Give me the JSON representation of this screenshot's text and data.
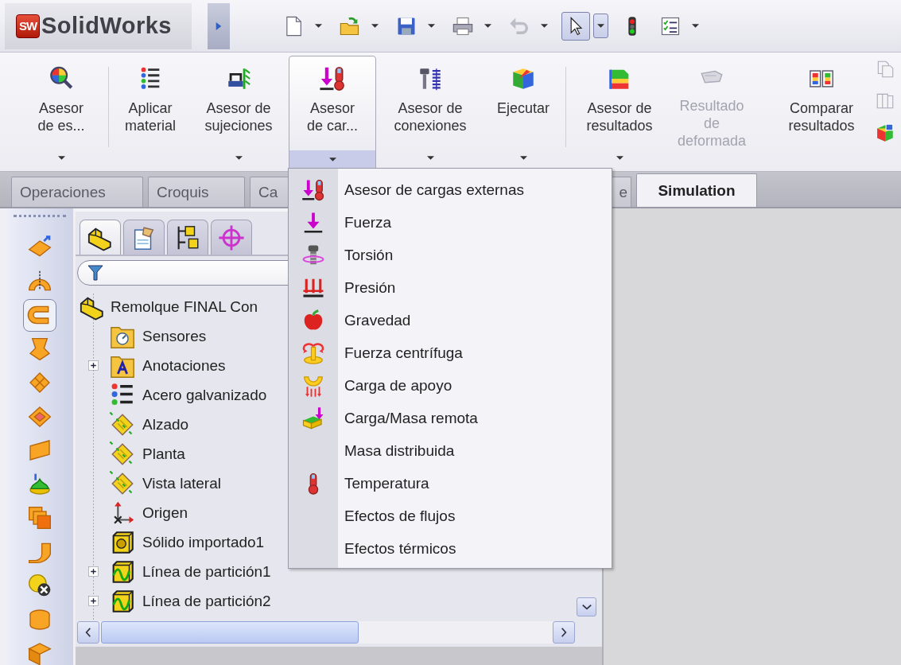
{
  "app": {
    "logo_mark": "SW",
    "name": "SolidWorks"
  },
  "quick_toolbar": [
    {
      "pressed": false,
      "disabled": false,
      "dropdown": true
    },
    {
      "pressed": false,
      "disabled": false,
      "dropdown": true
    },
    {
      "pressed": false,
      "disabled": false,
      "dropdown": true
    },
    {
      "pressed": false,
      "disabled": false,
      "dropdown": true
    },
    {
      "pressed": false,
      "disabled": true,
      "dropdown": true
    },
    {
      "pressed": true,
      "disabled": false,
      "dropdown": true
    },
    {
      "pressed": false,
      "disabled": false,
      "dropdown": false
    },
    {
      "pressed": false,
      "disabled": false,
      "dropdown": true
    }
  ],
  "ribbon": {
    "buttons": [
      {
        "lines": [
          "Asesor",
          "de es..."
        ],
        "dropdown": true,
        "pressed": false,
        "disabled": false
      },
      {
        "lines": [
          "Aplicar",
          "material"
        ],
        "dropdown": false,
        "pressed": false,
        "disabled": false
      },
      {
        "lines": [
          "Asesor de",
          "sujeciones"
        ],
        "dropdown": true,
        "pressed": false,
        "disabled": false
      },
      {
        "lines": [
          "Asesor",
          "de car..."
        ],
        "dropdown": true,
        "pressed": true,
        "disabled": false
      },
      {
        "lines": [
          "Asesor de",
          "conexiones"
        ],
        "dropdown": true,
        "pressed": false,
        "disabled": false
      },
      {
        "lines": [
          "Ejecutar"
        ],
        "dropdown": true,
        "pressed": false,
        "disabled": false
      },
      {
        "lines": [
          "Asesor de",
          "resultados"
        ],
        "dropdown": true,
        "pressed": false,
        "disabled": false
      },
      {
        "lines": [
          "Resultado",
          "de",
          "deformada"
        ],
        "dropdown": false,
        "pressed": false,
        "disabled": true
      },
      {
        "lines": [
          "Comparar",
          "resultados"
        ],
        "dropdown": false,
        "pressed": false,
        "disabled": false
      }
    ]
  },
  "tabs": [
    {
      "label": "Operaciones",
      "selected": false
    },
    {
      "label": "Croquis",
      "selected": false
    },
    {
      "label": "Ca",
      "selected": false
    },
    {
      "label": "e",
      "selected": false
    },
    {
      "label": "Simulation",
      "selected": true
    }
  ],
  "left_toolbar": {
    "tools": [
      {
        "selected": false
      },
      {
        "selected": false
      },
      {
        "selected": true
      },
      {
        "selected": false
      },
      {
        "selected": false
      },
      {
        "selected": false
      },
      {
        "selected": false
      },
      {
        "selected": false
      },
      {
        "selected": false
      },
      {
        "selected": false
      },
      {
        "selected": false
      },
      {
        "selected": false
      },
      {
        "selected": false
      }
    ]
  },
  "feature_manager": {
    "tabs": [
      {
        "selected": true
      },
      {
        "selected": false
      },
      {
        "selected": false
      },
      {
        "selected": false
      }
    ],
    "tree": {
      "label": "Remolque FINAL Con",
      "children": [
        {
          "label": "Sensores"
        },
        {
          "label": "Anotaciones",
          "expanded": false
        },
        {
          "label": "Acero galvanizado"
        },
        {
          "label": "Alzado"
        },
        {
          "label": "Planta"
        },
        {
          "label": "Vista lateral"
        },
        {
          "label": "Origen"
        },
        {
          "label": "Sólido importado1"
        },
        {
          "label": "Línea de partición1",
          "expanded": false
        },
        {
          "label": "Línea de partición2",
          "expanded": false
        }
      ]
    }
  },
  "dropdown_menu": {
    "items": [
      {
        "label": "Asesor de cargas externas"
      },
      {
        "label": "Fuerza"
      },
      {
        "label": "Torsión"
      },
      {
        "label": "Presión"
      },
      {
        "label": "Gravedad"
      },
      {
        "label": "Fuerza centrífuga"
      },
      {
        "label": "Carga de apoyo"
      },
      {
        "label": "Carga/Masa remota"
      },
      {
        "label": "Masa distribuida"
      },
      {
        "label": "Temperatura"
      },
      {
        "label": "Efectos de flujos"
      },
      {
        "label": "Efectos térmicos"
      }
    ]
  }
}
